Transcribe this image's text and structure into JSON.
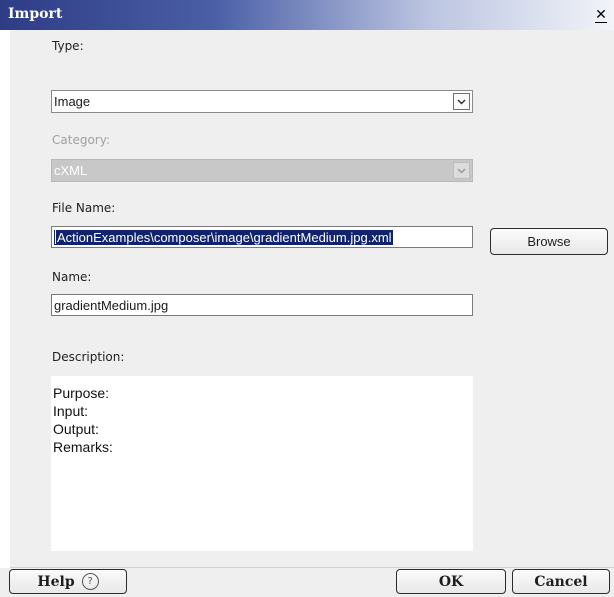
{
  "window": {
    "title": "Import",
    "close_symbol": "✕"
  },
  "type": {
    "label": "Type:",
    "value": "Image"
  },
  "category": {
    "label": "Category:",
    "value": "cXML"
  },
  "file_name": {
    "label": "File Name:",
    "value": "ActionExamples\\composer\\image\\gradientMedium.jpg.xml",
    "browse_label": "Browse"
  },
  "name": {
    "label": "Name:",
    "value": "gradientMedium.jpg"
  },
  "description": {
    "label": "Description:",
    "lines": [
      "Purpose:",
      "Input:",
      "Output:",
      "Remarks:"
    ]
  },
  "footer": {
    "help_label": "Help",
    "help_icon_glyph": "?",
    "ok_label": "OK",
    "cancel_label": "Cancel"
  }
}
